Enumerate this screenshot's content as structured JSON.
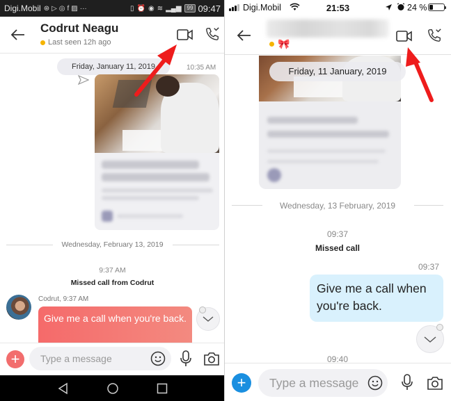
{
  "android": {
    "status_bar": {
      "carrier": "Digi.Mobil",
      "left_icons": [
        "messenger-icon",
        "play-icon",
        "whatsapp-icon",
        "facebook-icon",
        "photo-icon",
        "more-dots-icon"
      ],
      "left_glyphs": [
        "⊛",
        "▷",
        "◎",
        "f",
        "▨",
        "···"
      ],
      "right_icons": [
        "vibrate-icon",
        "alarm-icon",
        "eye-icon",
        "wifi-icon",
        "signal-icon"
      ],
      "right_glyphs": [
        "▯",
        "⏰",
        "◉",
        "≋",
        "▂▄▆"
      ],
      "battery": "99",
      "time": "09:47"
    },
    "header": {
      "title": "Codrut Neagu",
      "status": "Last seen 12h ago"
    },
    "chat": {
      "date_pill": "Friday, January 11, 2019",
      "shared_time": "10:35 AM",
      "divider_date": "Wednesday, February 13, 2019",
      "call_time": "9:37 AM",
      "missed_call": "Missed call from Codrut",
      "sender_line": "Codrut, 9:37 AM",
      "message": "Give me a call when you're back."
    },
    "composer": {
      "placeholder": "Type a message"
    },
    "colors": {
      "accent": "#f26d6d",
      "bubble_start": "#f56a6a",
      "bubble_end": "#f38a80"
    }
  },
  "ios": {
    "status_bar": {
      "carrier": "Digi.Mobil",
      "time": "21:53",
      "battery_text": "24 %",
      "battery_level": 0.24
    },
    "header": {
      "name_blurred": true,
      "mood_emoji": "🎀"
    },
    "chat": {
      "date_pill": "Friday, 11 January, 2019",
      "divider_date": "Wednesday, 13 February, 2019",
      "call_time": "09:37",
      "missed_call": "Missed call",
      "message_time": "09:37",
      "message": "Give me a call when you're back.",
      "next_time": "09:40"
    },
    "composer": {
      "placeholder": "Type a message"
    },
    "colors": {
      "accent": "#1a8fe0",
      "bubble": "#d9f1fd"
    }
  },
  "annotations": {
    "arrow_color": "#ee1c1c",
    "arrows_point_to": [
      "android-video-call-button",
      "ios-video-call-button"
    ]
  }
}
